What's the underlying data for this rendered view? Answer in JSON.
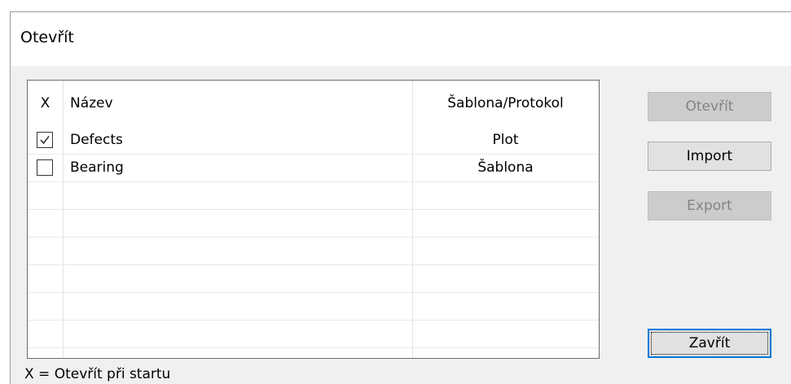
{
  "window": {
    "title": "Otevřít"
  },
  "table": {
    "headers": {
      "x": "X",
      "name": "Název",
      "type": "Šablona/Protokol"
    },
    "rows": [
      {
        "checked": true,
        "name": "Defects",
        "type": "Plot"
      },
      {
        "checked": false,
        "name": "Bearing",
        "type": "Šablona"
      },
      {
        "checked": null,
        "name": "",
        "type": ""
      },
      {
        "checked": null,
        "name": "",
        "type": ""
      },
      {
        "checked": null,
        "name": "",
        "type": ""
      },
      {
        "checked": null,
        "name": "",
        "type": ""
      },
      {
        "checked": null,
        "name": "",
        "type": ""
      },
      {
        "checked": null,
        "name": "",
        "type": ""
      }
    ]
  },
  "buttons": {
    "open": {
      "label": "Otevřít",
      "enabled": false
    },
    "import": {
      "label": "Import",
      "enabled": true
    },
    "export": {
      "label": "Export",
      "enabled": false
    },
    "close": {
      "label": "Zavřít",
      "enabled": true,
      "default": true
    }
  },
  "footer": {
    "note": "X = Otevřít při startu"
  },
  "colors": {
    "dialog_background": "#f0f0f0",
    "focus_border": "#0078d7",
    "disabled_text": "#838383"
  }
}
